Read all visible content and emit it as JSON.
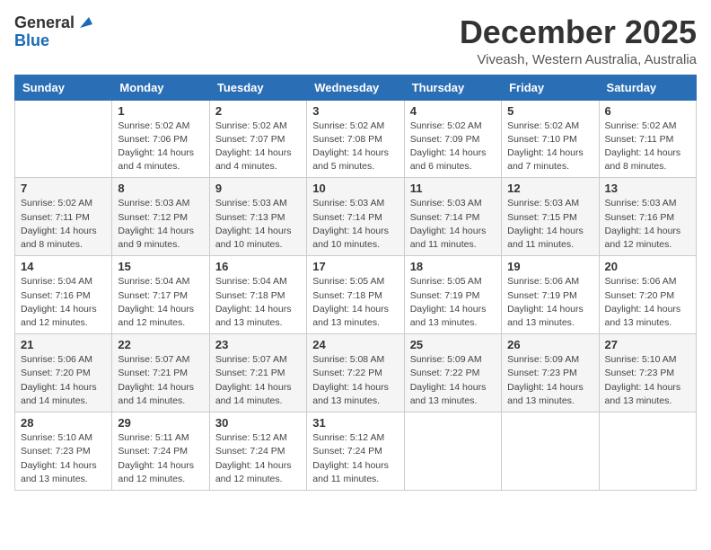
{
  "header": {
    "logo_general": "General",
    "logo_blue": "Blue",
    "month_title": "December 2025",
    "location": "Viveash, Western Australia, Australia"
  },
  "days_of_week": [
    "Sunday",
    "Monday",
    "Tuesday",
    "Wednesday",
    "Thursday",
    "Friday",
    "Saturday"
  ],
  "weeks": [
    [
      {
        "day": "",
        "info": ""
      },
      {
        "day": "1",
        "info": "Sunrise: 5:02 AM\nSunset: 7:06 PM\nDaylight: 14 hours\nand 4 minutes."
      },
      {
        "day": "2",
        "info": "Sunrise: 5:02 AM\nSunset: 7:07 PM\nDaylight: 14 hours\nand 4 minutes."
      },
      {
        "day": "3",
        "info": "Sunrise: 5:02 AM\nSunset: 7:08 PM\nDaylight: 14 hours\nand 5 minutes."
      },
      {
        "day": "4",
        "info": "Sunrise: 5:02 AM\nSunset: 7:09 PM\nDaylight: 14 hours\nand 6 minutes."
      },
      {
        "day": "5",
        "info": "Sunrise: 5:02 AM\nSunset: 7:10 PM\nDaylight: 14 hours\nand 7 minutes."
      },
      {
        "day": "6",
        "info": "Sunrise: 5:02 AM\nSunset: 7:11 PM\nDaylight: 14 hours\nand 8 minutes."
      }
    ],
    [
      {
        "day": "7",
        "info": "Sunrise: 5:02 AM\nSunset: 7:11 PM\nDaylight: 14 hours\nand 8 minutes."
      },
      {
        "day": "8",
        "info": "Sunrise: 5:03 AM\nSunset: 7:12 PM\nDaylight: 14 hours\nand 9 minutes."
      },
      {
        "day": "9",
        "info": "Sunrise: 5:03 AM\nSunset: 7:13 PM\nDaylight: 14 hours\nand 10 minutes."
      },
      {
        "day": "10",
        "info": "Sunrise: 5:03 AM\nSunset: 7:14 PM\nDaylight: 14 hours\nand 10 minutes."
      },
      {
        "day": "11",
        "info": "Sunrise: 5:03 AM\nSunset: 7:14 PM\nDaylight: 14 hours\nand 11 minutes."
      },
      {
        "day": "12",
        "info": "Sunrise: 5:03 AM\nSunset: 7:15 PM\nDaylight: 14 hours\nand 11 minutes."
      },
      {
        "day": "13",
        "info": "Sunrise: 5:03 AM\nSunset: 7:16 PM\nDaylight: 14 hours\nand 12 minutes."
      }
    ],
    [
      {
        "day": "14",
        "info": "Sunrise: 5:04 AM\nSunset: 7:16 PM\nDaylight: 14 hours\nand 12 minutes."
      },
      {
        "day": "15",
        "info": "Sunrise: 5:04 AM\nSunset: 7:17 PM\nDaylight: 14 hours\nand 12 minutes."
      },
      {
        "day": "16",
        "info": "Sunrise: 5:04 AM\nSunset: 7:18 PM\nDaylight: 14 hours\nand 13 minutes."
      },
      {
        "day": "17",
        "info": "Sunrise: 5:05 AM\nSunset: 7:18 PM\nDaylight: 14 hours\nand 13 minutes."
      },
      {
        "day": "18",
        "info": "Sunrise: 5:05 AM\nSunset: 7:19 PM\nDaylight: 14 hours\nand 13 minutes."
      },
      {
        "day": "19",
        "info": "Sunrise: 5:06 AM\nSunset: 7:19 PM\nDaylight: 14 hours\nand 13 minutes."
      },
      {
        "day": "20",
        "info": "Sunrise: 5:06 AM\nSunset: 7:20 PM\nDaylight: 14 hours\nand 13 minutes."
      }
    ],
    [
      {
        "day": "21",
        "info": "Sunrise: 5:06 AM\nSunset: 7:20 PM\nDaylight: 14 hours\nand 14 minutes."
      },
      {
        "day": "22",
        "info": "Sunrise: 5:07 AM\nSunset: 7:21 PM\nDaylight: 14 hours\nand 14 minutes."
      },
      {
        "day": "23",
        "info": "Sunrise: 5:07 AM\nSunset: 7:21 PM\nDaylight: 14 hours\nand 14 minutes."
      },
      {
        "day": "24",
        "info": "Sunrise: 5:08 AM\nSunset: 7:22 PM\nDaylight: 14 hours\nand 13 minutes."
      },
      {
        "day": "25",
        "info": "Sunrise: 5:09 AM\nSunset: 7:22 PM\nDaylight: 14 hours\nand 13 minutes."
      },
      {
        "day": "26",
        "info": "Sunrise: 5:09 AM\nSunset: 7:23 PM\nDaylight: 14 hours\nand 13 minutes."
      },
      {
        "day": "27",
        "info": "Sunrise: 5:10 AM\nSunset: 7:23 PM\nDaylight: 14 hours\nand 13 minutes."
      }
    ],
    [
      {
        "day": "28",
        "info": "Sunrise: 5:10 AM\nSunset: 7:23 PM\nDaylight: 14 hours\nand 13 minutes."
      },
      {
        "day": "29",
        "info": "Sunrise: 5:11 AM\nSunset: 7:24 PM\nDaylight: 14 hours\nand 12 minutes."
      },
      {
        "day": "30",
        "info": "Sunrise: 5:12 AM\nSunset: 7:24 PM\nDaylight: 14 hours\nand 12 minutes."
      },
      {
        "day": "31",
        "info": "Sunrise: 5:12 AM\nSunset: 7:24 PM\nDaylight: 14 hours\nand 11 minutes."
      },
      {
        "day": "",
        "info": ""
      },
      {
        "day": "",
        "info": ""
      },
      {
        "day": "",
        "info": ""
      }
    ]
  ]
}
